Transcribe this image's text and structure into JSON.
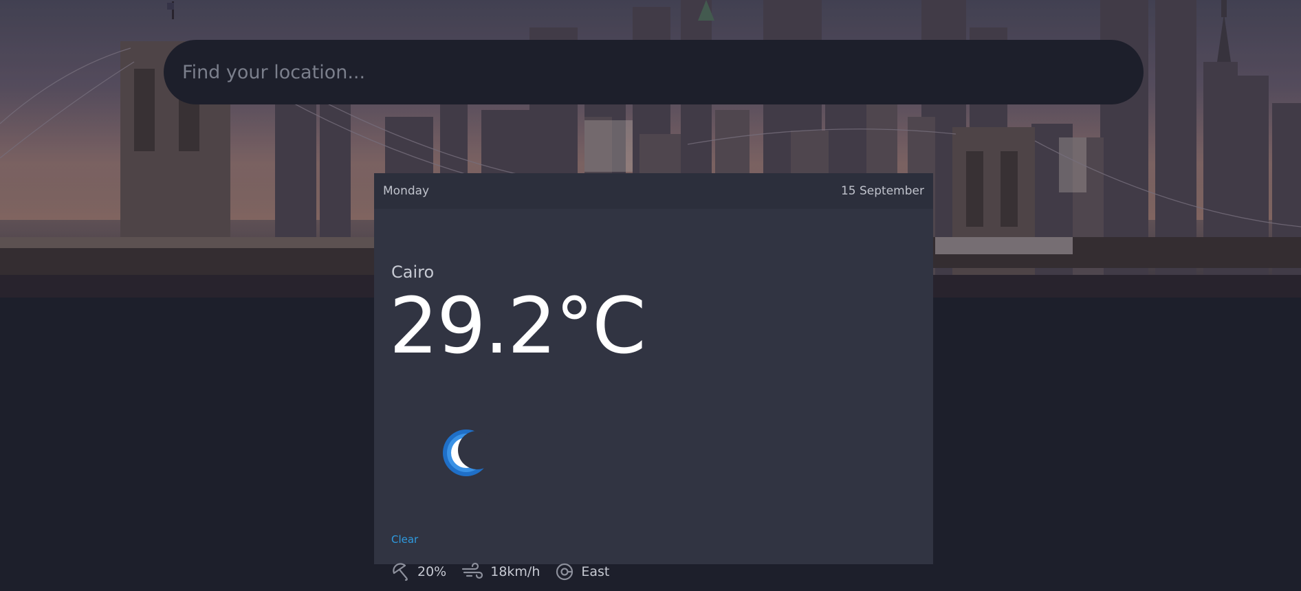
{
  "search": {
    "placeholder": "Find your location..."
  },
  "forecast": {
    "day": "Monday",
    "date": "15 September",
    "city": "Cairo",
    "temperature": "29.2°C",
    "condition": "Clear",
    "condition_icon": "moon-icon",
    "stats": {
      "rain_chance": "20%",
      "wind_speed": "18km/h",
      "wind_direction": "East"
    }
  },
  "colors": {
    "background": "#1d1f2b",
    "card": "#313442",
    "card_header": "#2c2f3c",
    "accent": "#2f9be0"
  }
}
